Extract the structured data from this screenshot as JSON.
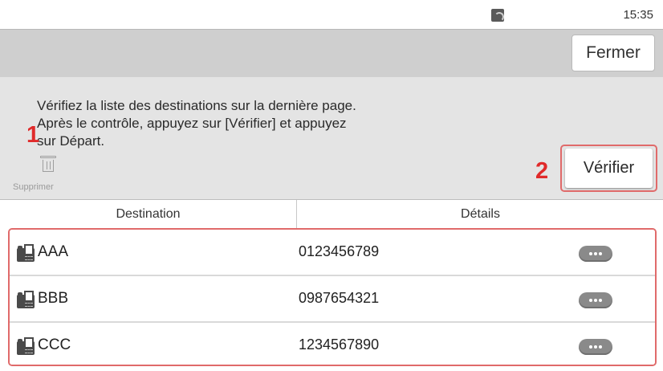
{
  "status_bar": {
    "clock": "15:35",
    "network_icon": "network-status-icon"
  },
  "header": {
    "close_label": "Fermer"
  },
  "message": {
    "lines": [
      "Vérifiez la liste des destinations sur la dernière page.",
      "Après le contrôle, appuyez sur [Vérifier] et appuyez",
      "sur Départ."
    ]
  },
  "toolbar": {
    "delete_label": "Supprimer",
    "delete_icon": "trash-icon",
    "verify_label": "Vérifier"
  },
  "callouts": {
    "one": "1",
    "two": "2"
  },
  "table": {
    "columns": [
      "Destination",
      "Détails"
    ],
    "rows": [
      {
        "name": "AAA",
        "number": "0123456789",
        "type_icon": "fax-icon",
        "action_icon": "more-icon"
      },
      {
        "name": "BBB",
        "number": "0987654321",
        "type_icon": "fax-icon",
        "action_icon": "more-icon"
      },
      {
        "name": "CCC",
        "number": "1234567890",
        "type_icon": "fax-icon",
        "action_icon": "more-icon"
      }
    ]
  },
  "colors": {
    "accent_highlight": "#e02a2a",
    "header_band": "#cfcfcf",
    "message_area": "#e4e4e4"
  }
}
